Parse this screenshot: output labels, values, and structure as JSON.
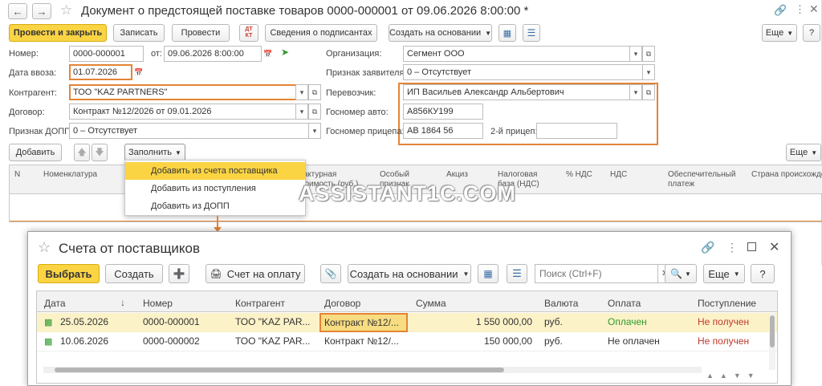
{
  "main": {
    "title": "Документ о предстоящей поставке товаров 0000-000001 от 09.06.2026 8:00:00 *",
    "toolbar": {
      "post_close": "Провести и закрыть",
      "save": "Записать",
      "post": "Провести",
      "dt_kt": "ДТ КТ",
      "signers": "Сведения о подписантах",
      "create_based": "Создать на основании",
      "more": "Еще"
    },
    "fields": {
      "number_label": "Номер:",
      "number_value": "0000-000001",
      "from_label": "от:",
      "from_value": "09.06.2026  8:00:00",
      "import_date_label": "Дата ввоза:",
      "import_date_value": "01.07.2026",
      "counterparty_label": "Контрагент:",
      "counterparty_value": "ТОО \"KAZ PARTNERS\"",
      "contract_label": "Договор:",
      "contract_value": "Контракт №12/2026 от 09.01.2026",
      "dopp_label": "Признак ДОПП:",
      "dopp_value": "0 – Отсутствует",
      "org_label": "Организация:",
      "org_value": "Сегмент ООО",
      "applicant_label": "Признак заявителя:",
      "applicant_value": "0 – Отсутствует",
      "carrier_label": "Перевозчик:",
      "carrier_value": "ИП Васильев Александр Альбертович",
      "auto_label": "Госномер авто:",
      "auto_value": "А856КУ199",
      "trailer_label": "Госномер прицепа:",
      "trailer_value": "АВ 1864 56",
      "trailer2_label": "2-й прицеп:",
      "trailer2_value": ""
    },
    "table_toolbar": {
      "add": "Добавить",
      "fill": "Заполнить",
      "more": "Еще"
    },
    "table_headers": [
      "N",
      "Номенклатура",
      "Фактурная стоимость (руб.)",
      "Особый признак",
      "Акциз",
      "Налоговая база (НДС)",
      "% НДС",
      "НДС",
      "Обеспечительный платеж",
      "Страна происхождения"
    ],
    "fill_menu": [
      "Добавить из счета поставщика",
      "Добавить из поступления",
      "Добавить из ДОПП"
    ]
  },
  "watermark": "ASSISTANT1C.COM",
  "popup": {
    "title": "Счета от поставщиков",
    "toolbar": {
      "select": "Выбрать",
      "create": "Создать",
      "invoice": "Счет на оплату",
      "create_based": "Создать на основании",
      "search_placeholder": "Поиск (Ctrl+F)",
      "more": "Еще",
      "help": "?"
    },
    "columns": [
      "Дата",
      "Номер",
      "Контрагент",
      "Договор",
      "Сумма",
      "Валюта",
      "Оплата",
      "Поступление"
    ],
    "rows": [
      {
        "date": "25.05.2026",
        "number": "0000-000001",
        "counterparty": "ТОО \"KAZ PAR...",
        "contract": "Контракт №12/...",
        "sum": "1 550 000,00",
        "currency": "руб.",
        "payment": "Оплачен",
        "receipt": "Не получен"
      },
      {
        "date": "10.06.2026",
        "number": "0000-000002",
        "counterparty": "ТОО \"KAZ PAR...",
        "contract": "Контракт №12/...",
        "sum": "150 000,00",
        "currency": "руб.",
        "payment": "Не оплачен",
        "receipt": "Не получен"
      }
    ]
  },
  "colors": {
    "accent": "#fbd444",
    "highlight_border": "#e38436",
    "paid": "#2d9b2d",
    "not_received": "#c0392b",
    "selected_row": "#fcf2c8"
  }
}
